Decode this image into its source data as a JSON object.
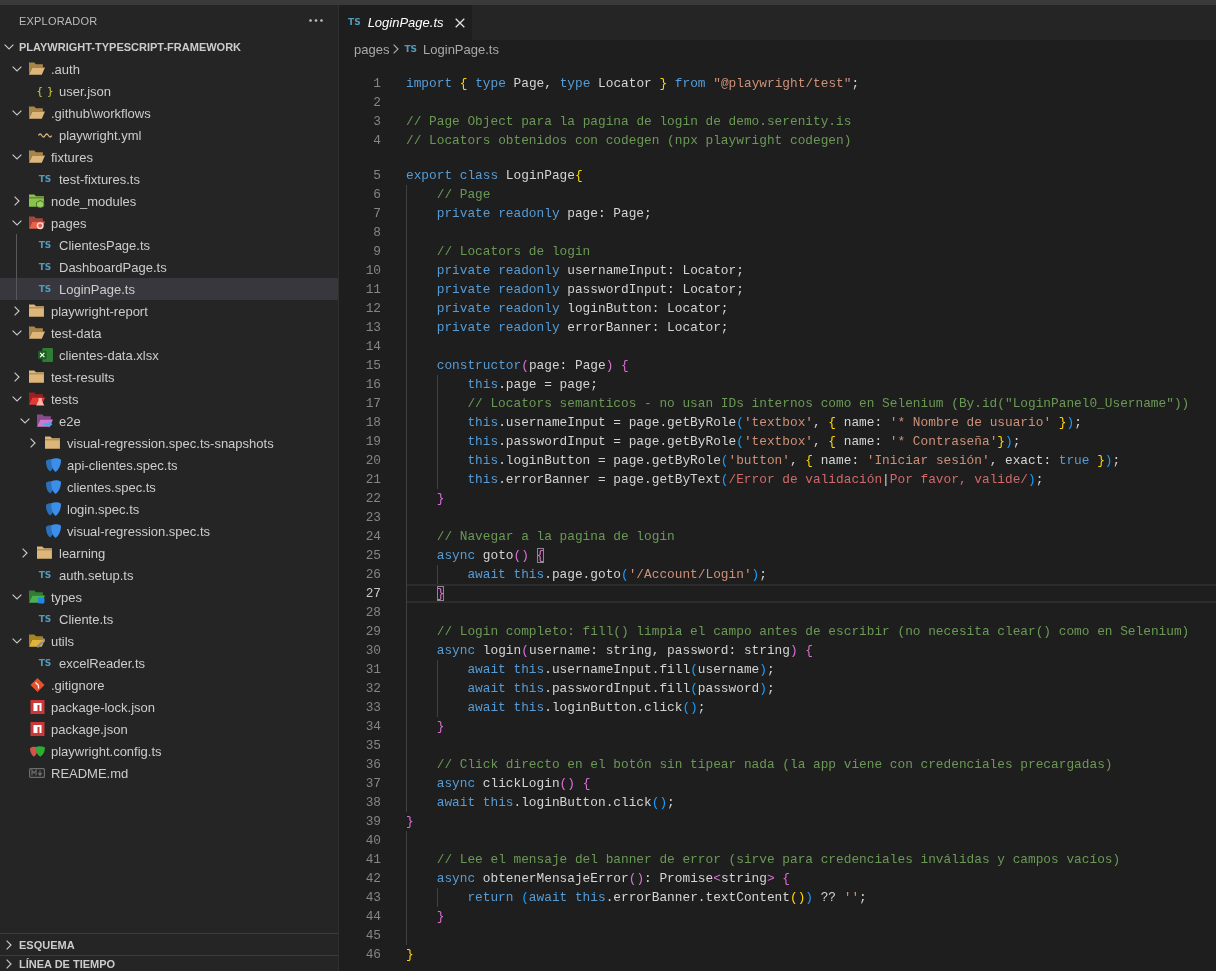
{
  "sidebar": {
    "title": "EXPLORADOR",
    "tree": {
      "name": "PLAYWRIGHT-TYPESCRIPT-FRAMEWORK",
      "expanded": true,
      "selected": false,
      "children": [
        {
          "name": ".auth",
          "kind": "folder",
          "expanded": true,
          "selected": false,
          "children": [
            {
              "name": "user.json",
              "kind": "json",
              "badge": "{ }",
              "selected": false
            }
          ]
        },
        {
          "name": ".github\\workflows",
          "kind": "folder",
          "expanded": true,
          "selected": false,
          "children": [
            {
              "name": "playwright.yml",
              "kind": "yaml",
              "selected": false
            }
          ]
        },
        {
          "name": "fixtures",
          "kind": "folder",
          "expanded": true,
          "selected": false,
          "children": [
            {
              "name": "test-fixtures.ts",
              "kind": "ts",
              "badge": "TS",
              "selected": false
            }
          ]
        },
        {
          "name": "node_modules",
          "kind": "node-folder",
          "expanded": false,
          "selected": false
        },
        {
          "name": "pages",
          "kind": "pages-folder",
          "expanded": true,
          "selected": false,
          "children": [
            {
              "name": "ClientesPage.ts",
              "kind": "ts",
              "badge": "TS",
              "selected": false
            },
            {
              "name": "DashboardPage.ts",
              "kind": "ts",
              "badge": "TS",
              "selected": false
            },
            {
              "name": "LoginPage.ts",
              "kind": "ts",
              "badge": "TS",
              "selected": true
            }
          ]
        },
        {
          "name": "playwright-report",
          "kind": "folder",
          "expanded": false,
          "selected": false
        },
        {
          "name": "test-data",
          "kind": "folder",
          "expanded": true,
          "selected": false,
          "children": [
            {
              "name": "clientes-data.xlsx",
              "kind": "xlsx",
              "selected": false
            }
          ]
        },
        {
          "name": "test-results",
          "kind": "folder",
          "expanded": false,
          "selected": false
        },
        {
          "name": "tests",
          "kind": "tests-folder",
          "expanded": true,
          "selected": false,
          "children": [
            {
              "name": "e2e",
              "kind": "e2e-folder",
              "expanded": true,
              "selected": false,
              "children": [
                {
                  "name": "visual-regression.spec.ts-snapshots",
                  "kind": "folder",
                  "expanded": false,
                  "selected": false
                },
                {
                  "name": "api-clientes.spec.ts",
                  "kind": "spec",
                  "selected": false
                },
                {
                  "name": "clientes.spec.ts",
                  "kind": "spec",
                  "selected": false
                },
                {
                  "name": "login.spec.ts",
                  "kind": "spec",
                  "selected": false
                },
                {
                  "name": "visual-regression.spec.ts",
                  "kind": "spec",
                  "selected": false
                }
              ]
            },
            {
              "name": "learning",
              "kind": "folder",
              "expanded": false,
              "selected": false
            },
            {
              "name": "auth.setup.ts",
              "kind": "ts",
              "badge": "TS",
              "selected": false
            }
          ]
        },
        {
          "name": "types",
          "kind": "types-folder",
          "expanded": true,
          "selected": false,
          "children": [
            {
              "name": "Cliente.ts",
              "kind": "ts",
              "badge": "TS",
              "selected": false
            }
          ]
        },
        {
          "name": "utils",
          "kind": "utils-folder",
          "expanded": true,
          "selected": false,
          "children": [
            {
              "name": "excelReader.ts",
              "kind": "ts",
              "badge": "TS",
              "selected": false
            }
          ]
        },
        {
          "name": ".gitignore",
          "kind": "git",
          "selected": false
        },
        {
          "name": "package-lock.json",
          "kind": "npm",
          "selected": false
        },
        {
          "name": "package.json",
          "kind": "npm",
          "selected": false
        },
        {
          "name": "playwright.config.ts",
          "kind": "config",
          "selected": false
        },
        {
          "name": "README.md",
          "kind": "md",
          "selected": false
        }
      ]
    },
    "panels": [
      {
        "title": "ESQUEMA",
        "expanded": false
      },
      {
        "title": "LÍNEA DE TIEMPO",
        "expanded": false
      }
    ]
  },
  "editor": {
    "tabs": [
      {
        "badge": "TS",
        "label": "LoginPage.ts",
        "selected": true,
        "preview": true
      }
    ],
    "breadcrumb": [
      {
        "label": "pages"
      },
      {
        "badge": "TS",
        "label": "LoginPage.ts"
      }
    ],
    "lines": [
      {
        "number": "1",
        "current": false,
        "tokens": [
          {
            "kind": "kw",
            "text": "import "
          },
          {
            "kind": "b1",
            "text": "{"
          },
          {
            "kind": "kw",
            "text": " type"
          },
          {
            "kind": "plain",
            "text": " Page, "
          },
          {
            "kind": "kw",
            "text": "type"
          },
          {
            "kind": "plain",
            "text": " Locator "
          },
          {
            "kind": "b1",
            "text": "}"
          },
          {
            "kind": "kw",
            "text": " from "
          },
          {
            "kind": "str",
            "text": "\"@playwright/test\""
          },
          {
            "kind": "plain",
            "text": ";"
          }
        ]
      },
      {
        "number": "2",
        "current": false
      },
      {
        "number": "3",
        "current": false,
        "tokens": [
          {
            "kind": "com",
            "text": "// Page Object para la pagina de login de demo.serenity.is"
          }
        ]
      },
      {
        "number": "4",
        "current": false,
        "tokens": [
          {
            "kind": "com",
            "text": "// Locators obtenidos con codegen (npx playwright codegen)"
          }
        ]
      },
      {
        "number": "5",
        "current": false,
        "tokens": [
          {
            "kind": "kw",
            "text": "export class "
          },
          {
            "kind": "plain",
            "text": "LoginPage"
          },
          {
            "kind": "b1",
            "text": "{"
          }
        ]
      },
      {
        "number": "6",
        "current": false,
        "tokens": [
          {
            "kind": "com",
            "text": "    // Page"
          }
        ]
      },
      {
        "number": "7",
        "current": false,
        "tokens": [
          {
            "kind": "kw",
            "text": "    private readonly"
          },
          {
            "kind": "plain",
            "text": " page: Page;"
          }
        ]
      },
      {
        "number": "8",
        "current": false
      },
      {
        "number": "9",
        "current": false,
        "tokens": [
          {
            "kind": "com",
            "text": "    // Locators de login"
          }
        ]
      },
      {
        "number": "10",
        "current": false,
        "tokens": [
          {
            "kind": "kw",
            "text": "    private readonly"
          },
          {
            "kind": "plain",
            "text": " usernameInput: Locator;"
          }
        ]
      },
      {
        "number": "11",
        "current": false,
        "tokens": [
          {
            "kind": "kw",
            "text": "    private readonly"
          },
          {
            "kind": "plain",
            "text": " passwordInput: Locator;"
          }
        ]
      },
      {
        "number": "12",
        "current": false,
        "tokens": [
          {
            "kind": "kw",
            "text": "    private readonly"
          },
          {
            "kind": "plain",
            "text": " loginButton: Locator;"
          }
        ]
      },
      {
        "number": "13",
        "current": false,
        "tokens": [
          {
            "kind": "kw",
            "text": "    private readonly"
          },
          {
            "kind": "plain",
            "text": " errorBanner: Locator;"
          }
        ]
      },
      {
        "number": "14",
        "current": false
      },
      {
        "number": "15",
        "current": false,
        "tokens": [
          {
            "kind": "kw",
            "text": "    constructor"
          },
          {
            "kind": "b2",
            "text": "("
          },
          {
            "kind": "plain",
            "text": "page: Page"
          },
          {
            "kind": "b2",
            "text": ") {"
          }
        ]
      },
      {
        "number": "16",
        "current": false,
        "tokens": [
          {
            "kind": "kw",
            "text": "        this"
          },
          {
            "kind": "plain",
            "text": ".page = page;"
          }
        ]
      },
      {
        "number": "17",
        "current": false,
        "tokens": [
          {
            "kind": "com",
            "text": "        // Locators semanticos - no usan IDs internos como en Selenium (By.id(\"LoginPanel0_Username\"))"
          }
        ]
      },
      {
        "number": "18",
        "current": false,
        "tokens": [
          {
            "kind": "kw",
            "text": "        this"
          },
          {
            "kind": "plain",
            "text": ".usernameInput = page.getByRole"
          },
          {
            "kind": "b3",
            "text": "("
          },
          {
            "kind": "str",
            "text": "'textbox'"
          },
          {
            "kind": "plain",
            "text": ", "
          },
          {
            "kind": "b1",
            "text": "{"
          },
          {
            "kind": "plain",
            "text": " name: "
          },
          {
            "kind": "str",
            "text": "'* Nombre de usuario'"
          },
          {
            "kind": "b1",
            "text": " }"
          },
          {
            "kind": "b3",
            "text": ")"
          },
          {
            "kind": "plain",
            "text": ";"
          }
        ]
      },
      {
        "number": "19",
        "current": false,
        "tokens": [
          {
            "kind": "kw",
            "text": "        this"
          },
          {
            "kind": "plain",
            "text": ".passwordInput = page.getByRole"
          },
          {
            "kind": "b3",
            "text": "("
          },
          {
            "kind": "str",
            "text": "'textbox'"
          },
          {
            "kind": "plain",
            "text": ", "
          },
          {
            "kind": "b1",
            "text": "{"
          },
          {
            "kind": "plain",
            "text": " name: "
          },
          {
            "kind": "str",
            "text": "'* Contraseña'"
          },
          {
            "kind": "b1",
            "text": "}"
          },
          {
            "kind": "b3",
            "text": ")"
          },
          {
            "kind": "plain",
            "text": ";"
          }
        ]
      },
      {
        "number": "20",
        "current": false,
        "tokens": [
          {
            "kind": "kw",
            "text": "        this"
          },
          {
            "kind": "plain",
            "text": ".loginButton = page.getByRole"
          },
          {
            "kind": "b3",
            "text": "("
          },
          {
            "kind": "str",
            "text": "'button'"
          },
          {
            "kind": "plain",
            "text": ", "
          },
          {
            "kind": "b1",
            "text": "{"
          },
          {
            "kind": "plain",
            "text": " name: "
          },
          {
            "kind": "str",
            "text": "'Iniciar sesión'"
          },
          {
            "kind": "plain",
            "text": ", exact: "
          },
          {
            "kind": "kw",
            "text": "true"
          },
          {
            "kind": "b1",
            "text": " }"
          },
          {
            "kind": "b3",
            "text": ")"
          },
          {
            "kind": "plain",
            "text": ";"
          }
        ]
      },
      {
        "number": "21",
        "current": false,
        "tokens": [
          {
            "kind": "kw",
            "text": "        this"
          },
          {
            "kind": "plain",
            "text": ".errorBanner = page.getByText"
          },
          {
            "kind": "b3",
            "text": "("
          },
          {
            "kind": "re",
            "text": "/Error de validación"
          },
          {
            "kind": "plain",
            "text": "|"
          },
          {
            "kind": "re",
            "text": "Por favor, valide/"
          },
          {
            "kind": "b3",
            "text": ")"
          },
          {
            "kind": "plain",
            "text": ";"
          }
        ]
      },
      {
        "number": "22",
        "current": false,
        "tokens": [
          {
            "kind": "b2",
            "text": "    }"
          }
        ]
      },
      {
        "number": "23",
        "current": false
      },
      {
        "number": "24",
        "current": false,
        "tokens": [
          {
            "kind": "com",
            "text": "    // Navegar a la pagina de login"
          }
        ]
      },
      {
        "number": "25",
        "current": false,
        "tokens": [
          {
            "kind": "kw",
            "text": "    async"
          },
          {
            "kind": "plain",
            "text": " goto"
          },
          {
            "kind": "b2",
            "text": "() "
          },
          {
            "kind": "match",
            "text": "{"
          }
        ]
      },
      {
        "number": "26",
        "current": false,
        "tokens": [
          {
            "kind": "kw",
            "text": "        await this"
          },
          {
            "kind": "plain",
            "text": ".page.goto"
          },
          {
            "kind": "b3",
            "text": "("
          },
          {
            "kind": "str",
            "text": "'/Account/Login'"
          },
          {
            "kind": "b3",
            "text": ")"
          },
          {
            "kind": "plain",
            "text": ";"
          }
        ]
      },
      {
        "number": "27",
        "current": true,
        "tokens": [
          {
            "kind": "match",
            "text": "    }"
          }
        ]
      },
      {
        "number": "28",
        "current": false
      },
      {
        "number": "29",
        "current": false,
        "tokens": [
          {
            "kind": "com",
            "text": "    // Login completo: fill() limpia el campo antes de escribir (no necesita clear() como en Selenium)"
          }
        ]
      },
      {
        "number": "30",
        "current": false,
        "tokens": [
          {
            "kind": "kw",
            "text": "    async"
          },
          {
            "kind": "plain",
            "text": " login"
          },
          {
            "kind": "b2",
            "text": "("
          },
          {
            "kind": "plain",
            "text": "username: string, password: string"
          },
          {
            "kind": "b2",
            "text": ") {"
          }
        ]
      },
      {
        "number": "31",
        "current": false,
        "tokens": [
          {
            "kind": "kw",
            "text": "        await this"
          },
          {
            "kind": "plain",
            "text": ".usernameInput.fill"
          },
          {
            "kind": "b3",
            "text": "("
          },
          {
            "kind": "plain",
            "text": "username"
          },
          {
            "kind": "b3",
            "text": ")"
          },
          {
            "kind": "plain",
            "text": ";"
          }
        ]
      },
      {
        "number": "32",
        "current": false,
        "tokens": [
          {
            "kind": "kw",
            "text": "        await this"
          },
          {
            "kind": "plain",
            "text": ".passwordInput.fill"
          },
          {
            "kind": "b3",
            "text": "("
          },
          {
            "kind": "plain",
            "text": "password"
          },
          {
            "kind": "b3",
            "text": ")"
          },
          {
            "kind": "plain",
            "text": ";"
          }
        ]
      },
      {
        "number": "33",
        "current": false,
        "tokens": [
          {
            "kind": "kw",
            "text": "        await this"
          },
          {
            "kind": "plain",
            "text": ".loginButton.click"
          },
          {
            "kind": "b3",
            "text": "()"
          },
          {
            "kind": "plain",
            "text": ";"
          }
        ]
      },
      {
        "number": "34",
        "current": false,
        "tokens": [
          {
            "kind": "b2",
            "text": "    }"
          }
        ]
      },
      {
        "number": "35",
        "current": false
      },
      {
        "number": "36",
        "current": false,
        "tokens": [
          {
            "kind": "com",
            "text": "    // Click directo en el botón sin tipear nada (la app viene con credenciales precargadas)"
          }
        ]
      },
      {
        "number": "37",
        "current": false,
        "tokens": [
          {
            "kind": "kw",
            "text": "    async"
          },
          {
            "kind": "plain",
            "text": " clickLogin"
          },
          {
            "kind": "b2",
            "text": "() {"
          }
        ]
      },
      {
        "number": "38",
        "current": false,
        "tokens": [
          {
            "kind": "kw",
            "text": "    await this"
          },
          {
            "kind": "plain",
            "text": ".loginButton.click"
          },
          {
            "kind": "b3",
            "text": "()"
          },
          {
            "kind": "plain",
            "text": ";"
          }
        ]
      },
      {
        "number": "39",
        "current": false,
        "tokens": [
          {
            "kind": "b2",
            "text": "}"
          }
        ]
      },
      {
        "number": "40",
        "current": false
      },
      {
        "number": "41",
        "current": false,
        "tokens": [
          {
            "kind": "com",
            "text": "    // Lee el mensaje del banner de error (sirve para credenciales inválidas y campos vacíos)"
          }
        ]
      },
      {
        "number": "42",
        "current": false,
        "tokens": [
          {
            "kind": "kw",
            "text": "    async"
          },
          {
            "kind": "plain",
            "text": " obtenerMensajeError"
          },
          {
            "kind": "b2",
            "text": "()"
          },
          {
            "kind": "plain",
            "text": ": Promise"
          },
          {
            "kind": "b2",
            "text": "<"
          },
          {
            "kind": "plain",
            "text": "string"
          },
          {
            "kind": "b2",
            "text": "> {"
          }
        ]
      },
      {
        "number": "43",
        "current": false,
        "tokens": [
          {
            "kind": "kw",
            "text": "        return "
          },
          {
            "kind": "b3",
            "text": "("
          },
          {
            "kind": "kw",
            "text": "await this"
          },
          {
            "kind": "plain",
            "text": ".errorBanner.textContent"
          },
          {
            "kind": "b1",
            "text": "()"
          },
          {
            "kind": "b3",
            "text": ")"
          },
          {
            "kind": "plain",
            "text": " ?? "
          },
          {
            "kind": "str",
            "text": "''"
          },
          {
            "kind": "plain",
            "text": ";"
          }
        ]
      },
      {
        "number": "44",
        "current": false,
        "tokens": [
          {
            "kind": "b2",
            "text": "    }"
          }
        ]
      },
      {
        "number": "45",
        "current": false
      },
      {
        "number": "46",
        "current": false,
        "tokens": [
          {
            "kind": "b1",
            "text": "}"
          }
        ]
      }
    ]
  }
}
